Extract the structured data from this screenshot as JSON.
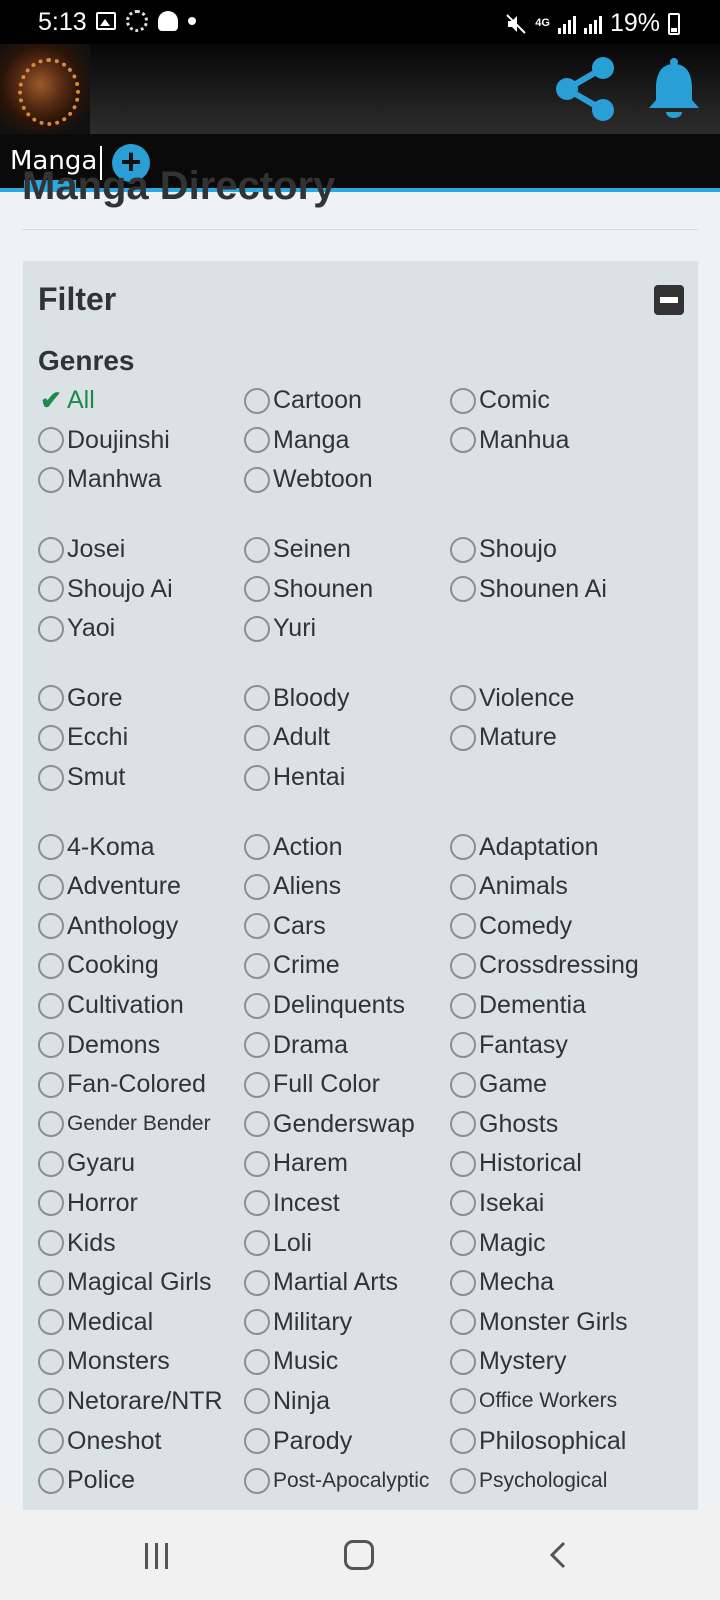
{
  "status_bar": {
    "time": "5:13",
    "network": "4G",
    "battery_percent": "19%",
    "icons_left": [
      "image-icon",
      "loading-ring-icon",
      "snapchat-icon",
      "notification-dot-icon"
    ],
    "icons_right": [
      "mute-icon",
      "network-4g-icon",
      "signal-icon",
      "battery-charging-icon"
    ]
  },
  "header": {
    "logo_icon": "app-logo",
    "share_icon": "share-icon",
    "bell_icon": "bell-icon",
    "accent_color": "#2a9fd6"
  },
  "tabs": {
    "active_tab": "Manga",
    "add_symbol": "+"
  },
  "page": {
    "title": "Manga Directory"
  },
  "filter": {
    "title": "Filter",
    "collapse_symbol": "minus-square-icon",
    "genres_heading": "Genres",
    "check_symbol": "✔",
    "groups": [
      [
        {
          "label": "All",
          "selected": true
        },
        {
          "label": "Cartoon"
        },
        {
          "label": "Comic"
        },
        {
          "label": "Doujinshi"
        },
        {
          "label": "Manga"
        },
        {
          "label": "Manhua"
        },
        {
          "label": "Manhwa"
        },
        {
          "label": "Webtoon"
        }
      ],
      [
        {
          "label": "Josei"
        },
        {
          "label": "Seinen"
        },
        {
          "label": "Shoujo"
        },
        {
          "label": "Shoujo Ai"
        },
        {
          "label": "Shounen"
        },
        {
          "label": "Shounen Ai"
        },
        {
          "label": "Yaoi"
        },
        {
          "label": "Yuri"
        }
      ],
      [
        {
          "label": "Gore"
        },
        {
          "label": "Bloody"
        },
        {
          "label": "Violence"
        },
        {
          "label": "Ecchi"
        },
        {
          "label": "Adult"
        },
        {
          "label": "Mature"
        },
        {
          "label": "Smut"
        },
        {
          "label": "Hentai"
        }
      ],
      [
        {
          "label": "4-Koma"
        },
        {
          "label": "Action"
        },
        {
          "label": "Adaptation"
        },
        {
          "label": "Adventure"
        },
        {
          "label": "Aliens"
        },
        {
          "label": "Animals"
        },
        {
          "label": "Anthology"
        },
        {
          "label": "Cars"
        },
        {
          "label": "Comedy"
        },
        {
          "label": "Cooking"
        },
        {
          "label": "Crime"
        },
        {
          "label": "Crossdressing"
        },
        {
          "label": "Cultivation"
        },
        {
          "label": "Delinquents"
        },
        {
          "label": "Dementia"
        },
        {
          "label": "Demons"
        },
        {
          "label": "Drama"
        },
        {
          "label": "Fantasy"
        },
        {
          "label": "Fan-Colored"
        },
        {
          "label": "Full Color"
        },
        {
          "label": "Game"
        },
        {
          "label": "Gender Bender",
          "small": true
        },
        {
          "label": "Genderswap"
        },
        {
          "label": "Ghosts"
        },
        {
          "label": "Gyaru"
        },
        {
          "label": "Harem"
        },
        {
          "label": "Historical"
        },
        {
          "label": "Horror"
        },
        {
          "label": "Incest"
        },
        {
          "label": "Isekai"
        },
        {
          "label": "Kids"
        },
        {
          "label": "Loli"
        },
        {
          "label": "Magic"
        },
        {
          "label": "Magical Girls"
        },
        {
          "label": "Martial Arts"
        },
        {
          "label": "Mecha"
        },
        {
          "label": "Medical"
        },
        {
          "label": "Military"
        },
        {
          "label": "Monster Girls"
        },
        {
          "label": "Monsters"
        },
        {
          "label": "Music"
        },
        {
          "label": "Mystery"
        },
        {
          "label": "Netorare/NTR"
        },
        {
          "label": "Ninja"
        },
        {
          "label": "Office Workers",
          "small": true
        },
        {
          "label": "Oneshot"
        },
        {
          "label": "Parody"
        },
        {
          "label": "Philosophical"
        },
        {
          "label": "Police"
        },
        {
          "label": "Post-Apocalyptic",
          "small": true
        },
        {
          "label": "Psychological",
          "small": true
        }
      ]
    ]
  },
  "nav_bar": {
    "recent_icon": "recent-apps-icon",
    "home_icon": "home-icon",
    "back_icon": "back-icon"
  }
}
